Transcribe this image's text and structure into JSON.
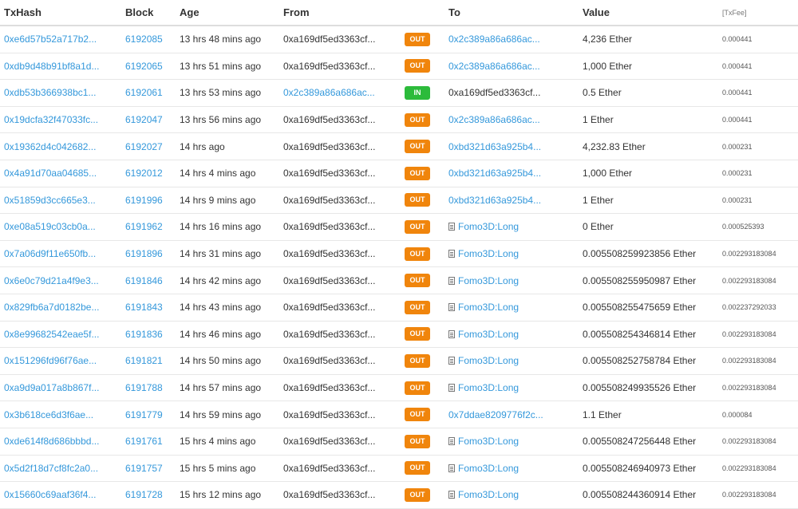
{
  "columns": {
    "txhash": "TxHash",
    "block": "Block",
    "age": "Age",
    "from": "From",
    "to": "To",
    "value": "Value",
    "fee": "[TxFee]"
  },
  "rows": [
    {
      "txhash": "0xe6d57b52a717b2...",
      "block": "6192085",
      "age": "13 hrs 48 mins ago",
      "from": "0xa169df5ed3363cf...",
      "from_link": false,
      "direction": "OUT",
      "to": "0x2c389a86a686ac...",
      "to_type": "address",
      "value": "4,236 Ether",
      "fee": "0.000441"
    },
    {
      "txhash": "0xdb9d48b91bf8a1d...",
      "block": "6192065",
      "age": "13 hrs 51 mins ago",
      "from": "0xa169df5ed3363cf...",
      "from_link": false,
      "direction": "OUT",
      "to": "0x2c389a86a686ac...",
      "to_type": "address",
      "value": "1,000 Ether",
      "fee": "0.000441"
    },
    {
      "txhash": "0xdb53b366938bc1...",
      "block": "6192061",
      "age": "13 hrs 53 mins ago",
      "from": "0x2c389a86a686ac...",
      "from_link": true,
      "direction": "IN",
      "to": "0xa169df5ed3363cf...",
      "to_type": "self",
      "value": "0.5 Ether",
      "fee": "0.000441"
    },
    {
      "txhash": "0x19dcfa32f47033fc...",
      "block": "6192047",
      "age": "13 hrs 56 mins ago",
      "from": "0xa169df5ed3363cf...",
      "from_link": false,
      "direction": "OUT",
      "to": "0x2c389a86a686ac...",
      "to_type": "address",
      "value": "1 Ether",
      "fee": "0.000441"
    },
    {
      "txhash": "0x19362d4c042682...",
      "block": "6192027",
      "age": "14 hrs ago",
      "from": "0xa169df5ed3363cf...",
      "from_link": false,
      "direction": "OUT",
      "to": "0xbd321d63a925b4...",
      "to_type": "address",
      "value": "4,232.83 Ether",
      "fee": "0.000231"
    },
    {
      "txhash": "0x4a91d70aa04685...",
      "block": "6192012",
      "age": "14 hrs 4 mins ago",
      "from": "0xa169df5ed3363cf...",
      "from_link": false,
      "direction": "OUT",
      "to": "0xbd321d63a925b4...",
      "to_type": "address",
      "value": "1,000 Ether",
      "fee": "0.000231"
    },
    {
      "txhash": "0x51859d3cc665e3...",
      "block": "6191996",
      "age": "14 hrs 9 mins ago",
      "from": "0xa169df5ed3363cf...",
      "from_link": false,
      "direction": "OUT",
      "to": "0xbd321d63a925b4...",
      "to_type": "address",
      "value": "1 Ether",
      "fee": "0.000231"
    },
    {
      "txhash": "0xe08a519c03cb0a...",
      "block": "6191962",
      "age": "14 hrs 16 mins ago",
      "from": "0xa169df5ed3363cf...",
      "from_link": false,
      "direction": "OUT",
      "to": "Fomo3D:Long",
      "to_type": "contract",
      "value": "0 Ether",
      "fee": "0.000525393"
    },
    {
      "txhash": "0x7a06d9f11e650fb...",
      "block": "6191896",
      "age": "14 hrs 31 mins ago",
      "from": "0xa169df5ed3363cf...",
      "from_link": false,
      "direction": "OUT",
      "to": "Fomo3D:Long",
      "to_type": "contract",
      "value": "0.005508259923856 Ether",
      "fee": "0.002293183084"
    },
    {
      "txhash": "0x6e0c79d21a4f9e3...",
      "block": "6191846",
      "age": "14 hrs 42 mins ago",
      "from": "0xa169df5ed3363cf...",
      "from_link": false,
      "direction": "OUT",
      "to": "Fomo3D:Long",
      "to_type": "contract",
      "value": "0.005508255950987 Ether",
      "fee": "0.002293183084"
    },
    {
      "txhash": "0x829fb6a7d0182be...",
      "block": "6191843",
      "age": "14 hrs 43 mins ago",
      "from": "0xa169df5ed3363cf...",
      "from_link": false,
      "direction": "OUT",
      "to": "Fomo3D:Long",
      "to_type": "contract",
      "value": "0.005508255475659 Ether",
      "fee": "0.002237292033"
    },
    {
      "txhash": "0x8e99682542eae5f...",
      "block": "6191836",
      "age": "14 hrs 46 mins ago",
      "from": "0xa169df5ed3363cf...",
      "from_link": false,
      "direction": "OUT",
      "to": "Fomo3D:Long",
      "to_type": "contract",
      "value": "0.005508254346814 Ether",
      "fee": "0.002293183084"
    },
    {
      "txhash": "0x151296fd96f76ae...",
      "block": "6191821",
      "age": "14 hrs 50 mins ago",
      "from": "0xa169df5ed3363cf...",
      "from_link": false,
      "direction": "OUT",
      "to": "Fomo3D:Long",
      "to_type": "contract",
      "value": "0.005508252758784 Ether",
      "fee": "0.002293183084"
    },
    {
      "txhash": "0xa9d9a017a8b867f...",
      "block": "6191788",
      "age": "14 hrs 57 mins ago",
      "from": "0xa169df5ed3363cf...",
      "from_link": false,
      "direction": "OUT",
      "to": "Fomo3D:Long",
      "to_type": "contract",
      "value": "0.005508249935526 Ether",
      "fee": "0.002293183084"
    },
    {
      "txhash": "0x3b618ce6d3f6ae...",
      "block": "6191779",
      "age": "14 hrs 59 mins ago",
      "from": "0xa169df5ed3363cf...",
      "from_link": false,
      "direction": "OUT",
      "to": "0x7ddae8209776f2c...",
      "to_type": "address",
      "value": "1.1 Ether",
      "fee": "0.000084"
    },
    {
      "txhash": "0xde614f8d686bbbd...",
      "block": "6191761",
      "age": "15 hrs 4 mins ago",
      "from": "0xa169df5ed3363cf...",
      "from_link": false,
      "direction": "OUT",
      "to": "Fomo3D:Long",
      "to_type": "contract",
      "value": "0.005508247256448 Ether",
      "fee": "0.002293183084"
    },
    {
      "txhash": "0x5d2f18d7cf8fc2a0...",
      "block": "6191757",
      "age": "15 hrs 5 mins ago",
      "from": "0xa169df5ed3363cf...",
      "from_link": false,
      "direction": "OUT",
      "to": "Fomo3D:Long",
      "to_type": "contract",
      "value": "0.005508246940973 Ether",
      "fee": "0.002293183084"
    },
    {
      "txhash": "0x15660c69aaf36f4...",
      "block": "6191728",
      "age": "15 hrs 12 mins ago",
      "from": "0xa169df5ed3363cf...",
      "from_link": false,
      "direction": "OUT",
      "to": "Fomo3D:Long",
      "to_type": "contract",
      "value": "0.005508244360914 Ether",
      "fee": "0.002293183084"
    }
  ]
}
